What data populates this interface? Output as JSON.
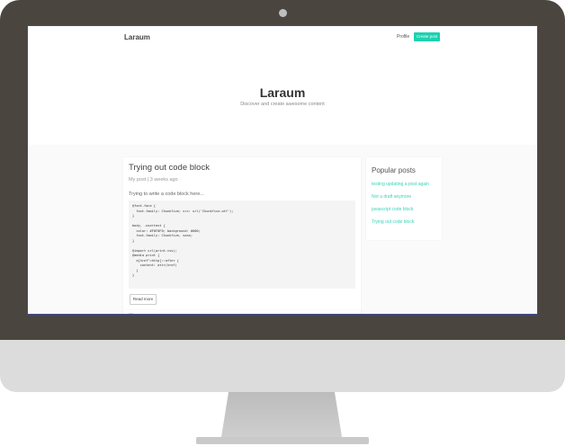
{
  "site": {
    "brand": "Laraum",
    "nav": {
      "profile_label": "Profile",
      "create_label": "Create post"
    },
    "hero": {
      "title": "Laraum",
      "subtitle": "Discover and create awesome content"
    }
  },
  "post": {
    "title": "Trying out code block",
    "meta": "My post | 3 weeks ago",
    "excerpt": "Trying to write a code block here...",
    "code": "@font-face {\n  font-family: Chunkfive; src: url('Chunkfive.otf');\n}\n\nbody, .usertext {\n  color: #F0F0F0; background: #600;\n  font-family: Chunkfive, sans;\n}\n\n@import url(print.css);\n@media print {\n  a[href^=http]::after {\n    content: attr(href)\n  }\n}",
    "read_more_label": "Read more"
  },
  "sidebar": {
    "title": "Popular posts",
    "items": [
      {
        "label": "testing updating a post again"
      },
      {
        "label": "Not a draft anymore"
      },
      {
        "label": "javascript code block"
      },
      {
        "label": "Trying out code block"
      }
    ]
  },
  "colors": {
    "accent": "#1dd1b0",
    "link": "#3dd2b5",
    "bezel": "#4b4540",
    "chin": "#dcdcdc"
  }
}
